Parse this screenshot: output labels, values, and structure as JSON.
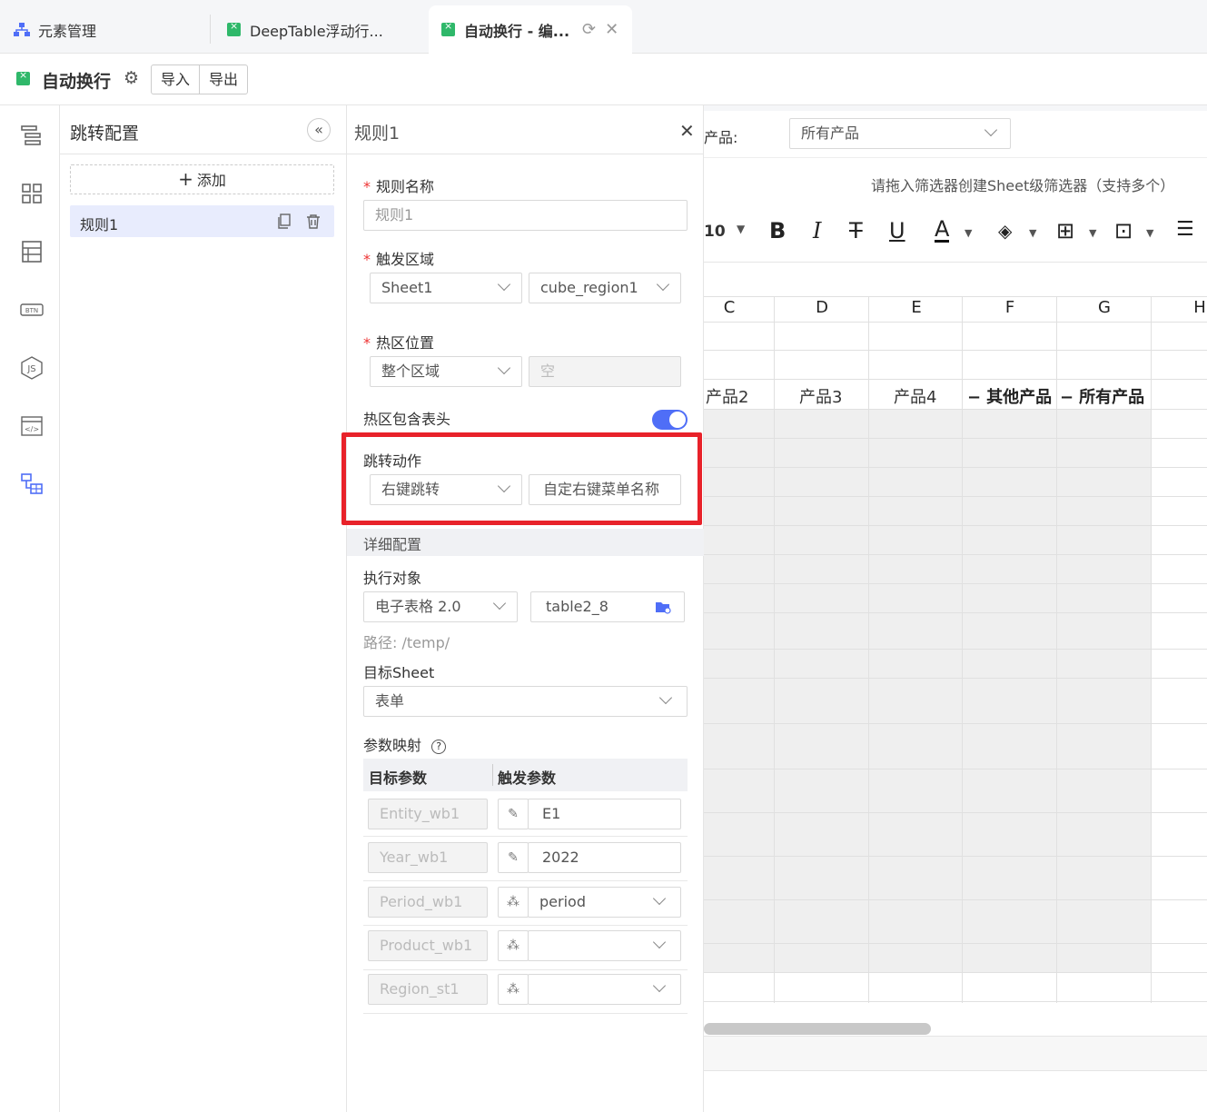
{
  "tabs": [
    {
      "label": "元素管理"
    },
    {
      "label": "DeepTable浮动行..."
    },
    {
      "label": "自动换行 - 编..."
    }
  ],
  "toolbar": {
    "title": "自动换行",
    "import": "导入",
    "export": "导出"
  },
  "config": {
    "title": "跳转配置",
    "add": "添加",
    "rule_item": "规则1"
  },
  "rule": {
    "title": "规则1",
    "name_label": "规则名称",
    "name_value": "规则1",
    "trigger_label": "触发区域",
    "trigger_sheet": "Sheet1",
    "trigger_region": "cube_region1",
    "hot_label": "热区位置",
    "hot_value": "整个区域",
    "hot_empty": "空",
    "include_header": "热区包含表头",
    "jump_label": "跳转动作",
    "jump_value": "右键跳转",
    "jump_menu": "自定右键菜单名称",
    "detail": "详细配置",
    "target_label": "执行对象",
    "target_type": "电子表格 2.0",
    "target_table": "table2_8",
    "path": "路径: /temp/",
    "sheet_label": "目标Sheet",
    "sheet_value": "表单",
    "map_label": "参数映射",
    "map_head_target": "目标参数",
    "map_head_trigger": "触发参数",
    "mappings": [
      {
        "target": "Entity_wb1",
        "value": "E1"
      },
      {
        "target": "Year_wb1",
        "value": "2022"
      },
      {
        "target": "Period_wb1",
        "value": "period"
      },
      {
        "target": "Product_wb1",
        "value": ""
      },
      {
        "target": "Region_st1",
        "value": ""
      }
    ]
  },
  "sheet": {
    "filter_label": "产品:",
    "filter_value": "所有产品",
    "drop_hint": "请拖入筛选器创建Sheet级筛选器（支持多个）",
    "font_size": "10",
    "columns": [
      "C",
      "D",
      "E",
      "F",
      "G",
      "H"
    ],
    "headers": [
      "产品2",
      "产品3",
      "产品4",
      "其他产品",
      "所有产品"
    ]
  },
  "colors": {
    "accent": "#4f6ef7",
    "highlight": "#e8222a",
    "excel_green": "#2fb86a"
  }
}
